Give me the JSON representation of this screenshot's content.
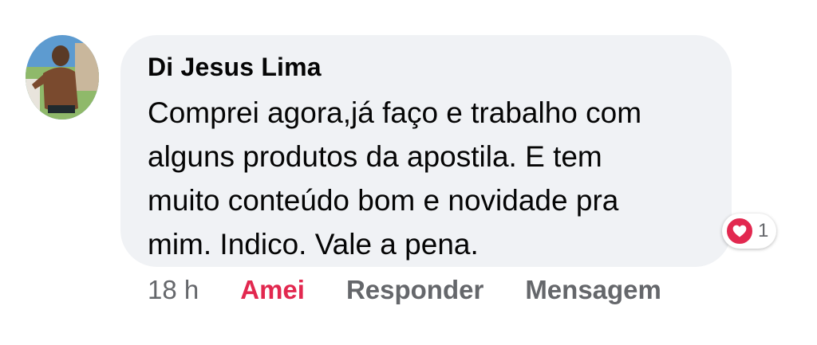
{
  "comment": {
    "author": "Di Jesus Lima",
    "text_lines": [
      "Comprei agora,já faço e trabalho com",
      "alguns produtos da apostila. E tem",
      "muito conteúdo bom e novidade pra",
      "mim. Indico. Vale a pena."
    ],
    "reaction": {
      "icon": "heart-icon",
      "count": "1",
      "color": "#e2284f"
    }
  },
  "actions": {
    "time": "18 h",
    "love_label": "Amei",
    "reply_label": "Responder",
    "message_label": "Mensagem"
  },
  "colors": {
    "bubble": "#f0f2f5",
    "secondary_text": "#65676b",
    "love": "#e2284f"
  }
}
